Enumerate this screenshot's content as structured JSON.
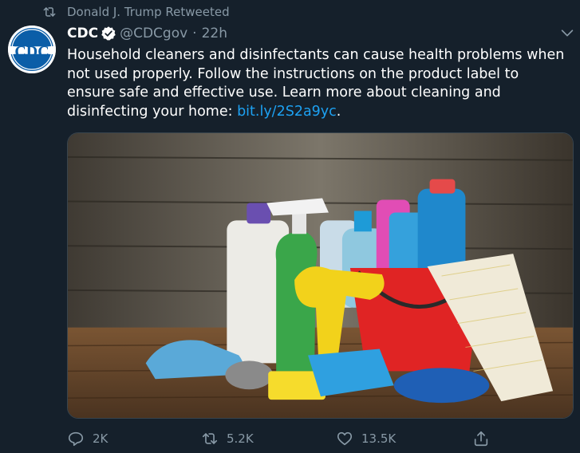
{
  "social_context": {
    "text": "Donald J. Trump Retweeted",
    "icon": "retweet-icon"
  },
  "author": {
    "name": "CDC",
    "handle": "@CDCgov",
    "separator": "·",
    "time": "22h",
    "verified": true,
    "avatar_text": "CDC",
    "avatar_colors": {
      "background": "#ffffff",
      "ring": "#0b5ea8",
      "text": "#ffffff"
    }
  },
  "tweet": {
    "text": "Household cleaners and disinfectants can cause health problems when not used properly. Follow the instructions on the product label to ensure safe and effective use. Learn more about cleaning and disinfecting your home: ",
    "link": "bit.ly/2S2a9yc",
    "trailing": "."
  },
  "media": {
    "icon": "photo-cleaning-products"
  },
  "actions": {
    "reply_count": "2K",
    "retweet_count": "5.2K",
    "like_count": "13.5K"
  },
  "colors": {
    "background": "#15202b",
    "secondary_text": "#8899a6",
    "link": "#1da1f2",
    "verified_badge": "#ffffff"
  }
}
